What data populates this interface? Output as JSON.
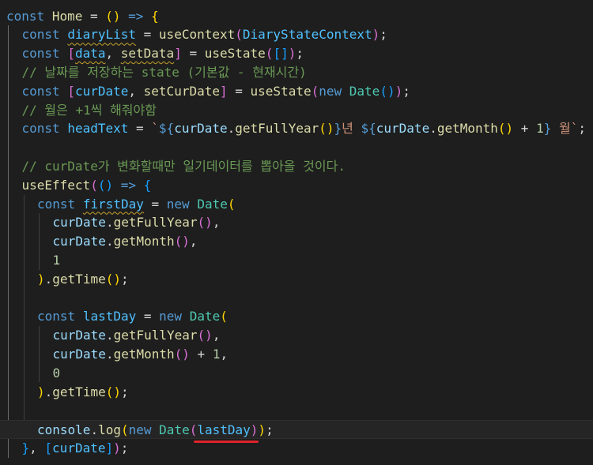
{
  "colors": {
    "background": "#1e1e1e",
    "keyword": "#569cd6",
    "control": "#c586c0",
    "function": "#dcdcaa",
    "variable": "#9cdcfe",
    "constant": "#4fc1ff",
    "type": "#4ec9b0",
    "number": "#b5cea8",
    "string": "#ce9178",
    "comment": "#6a9955",
    "text": "#d4d4d4",
    "bracket1": "#ffd700",
    "bracket2": "#da70d6",
    "bracket3": "#179fff",
    "guide": "#404040",
    "active_guide": "#6b6b6b",
    "annotation": "#e0232a"
  },
  "code": {
    "lines": [
      {
        "indent": 0,
        "tokens": [
          {
            "t": "const",
            "c": "#569cd6"
          },
          {
            "t": " ",
            "c": "#d4d4d4"
          },
          {
            "t": "Home",
            "c": "#dcdcaa"
          },
          {
            "t": " = ",
            "c": "#d4d4d4"
          },
          {
            "t": "()",
            "c": "#ffd700"
          },
          {
            "t": " ",
            "c": "#d4d4d4"
          },
          {
            "t": "=>",
            "c": "#569cd6"
          },
          {
            "t": " ",
            "c": "#d4d4d4"
          },
          {
            "t": "{",
            "c": "#ffd700"
          }
        ]
      },
      {
        "indent": 1,
        "tokens": [
          {
            "t": "const",
            "c": "#569cd6"
          },
          {
            "t": " ",
            "c": "#d4d4d4"
          },
          {
            "t": "diaryList",
            "c": "#4fc1ff",
            "s": 1
          },
          {
            "t": " = ",
            "c": "#d4d4d4"
          },
          {
            "t": "useContext",
            "c": "#dcdcaa"
          },
          {
            "t": "(",
            "c": "#da70d6"
          },
          {
            "t": "DiaryStateContext",
            "c": "#4fc1ff"
          },
          {
            "t": ")",
            "c": "#da70d6"
          },
          {
            "t": ";",
            "c": "#d4d4d4"
          }
        ]
      },
      {
        "indent": 1,
        "tokens": [
          {
            "t": "const",
            "c": "#569cd6"
          },
          {
            "t": " ",
            "c": "#d4d4d4"
          },
          {
            "t": "[",
            "c": "#da70d6"
          },
          {
            "t": "data",
            "c": "#4fc1ff",
            "s": 1
          },
          {
            "t": ", ",
            "c": "#d4d4d4"
          },
          {
            "t": "setData",
            "c": "#dcdcaa",
            "s": 1
          },
          {
            "t": "]",
            "c": "#da70d6"
          },
          {
            "t": " = ",
            "c": "#d4d4d4"
          },
          {
            "t": "useState",
            "c": "#dcdcaa"
          },
          {
            "t": "(",
            "c": "#da70d6"
          },
          {
            "t": "[]",
            "c": "#179fff"
          },
          {
            "t": ")",
            "c": "#da70d6"
          },
          {
            "t": ";",
            "c": "#d4d4d4"
          }
        ]
      },
      {
        "indent": 1,
        "tokens": [
          {
            "t": "// 날짜를 저장하는 state (기본값 - 현재시간)",
            "c": "#6a9955"
          }
        ]
      },
      {
        "indent": 1,
        "tokens": [
          {
            "t": "const",
            "c": "#569cd6"
          },
          {
            "t": " ",
            "c": "#d4d4d4"
          },
          {
            "t": "[",
            "c": "#da70d6"
          },
          {
            "t": "curDate",
            "c": "#4fc1ff"
          },
          {
            "t": ", ",
            "c": "#d4d4d4"
          },
          {
            "t": "setCurDate",
            "c": "#dcdcaa"
          },
          {
            "t": "]",
            "c": "#da70d6"
          },
          {
            "t": " = ",
            "c": "#d4d4d4"
          },
          {
            "t": "useState",
            "c": "#dcdcaa"
          },
          {
            "t": "(",
            "c": "#da70d6"
          },
          {
            "t": "new",
            "c": "#569cd6"
          },
          {
            "t": " ",
            "c": "#d4d4d4"
          },
          {
            "t": "Date",
            "c": "#4ec9b0"
          },
          {
            "t": "()",
            "c": "#179fff"
          },
          {
            "t": ")",
            "c": "#da70d6"
          },
          {
            "t": ";",
            "c": "#d4d4d4"
          }
        ]
      },
      {
        "indent": 1,
        "tokens": [
          {
            "t": "// 월은 +1씩 해줘야함",
            "c": "#6a9955"
          }
        ]
      },
      {
        "indent": 1,
        "tokens": [
          {
            "t": "const",
            "c": "#569cd6"
          },
          {
            "t": " ",
            "c": "#d4d4d4"
          },
          {
            "t": "headText",
            "c": "#4fc1ff"
          },
          {
            "t": " = ",
            "c": "#d4d4d4"
          },
          {
            "t": "`",
            "c": "#ce9178"
          },
          {
            "t": "${",
            "c": "#569cd6"
          },
          {
            "t": "curDate",
            "c": "#9cdcfe"
          },
          {
            "t": ".",
            "c": "#d4d4d4"
          },
          {
            "t": "getFullYear",
            "c": "#dcdcaa"
          },
          {
            "t": "()",
            "c": "#ffd700"
          },
          {
            "t": "}",
            "c": "#569cd6"
          },
          {
            "t": "년 ",
            "c": "#ce9178"
          },
          {
            "t": "${",
            "c": "#569cd6"
          },
          {
            "t": "curDate",
            "c": "#9cdcfe"
          },
          {
            "t": ".",
            "c": "#d4d4d4"
          },
          {
            "t": "getMonth",
            "c": "#dcdcaa"
          },
          {
            "t": "()",
            "c": "#ffd700"
          },
          {
            "t": " + ",
            "c": "#d4d4d4"
          },
          {
            "t": "1",
            "c": "#b5cea8"
          },
          {
            "t": "}",
            "c": "#569cd6"
          },
          {
            "t": " 월`",
            "c": "#ce9178"
          },
          {
            "t": ";",
            "c": "#d4d4d4"
          }
        ]
      },
      {
        "indent": 1,
        "tokens": []
      },
      {
        "indent": 1,
        "tokens": [
          {
            "t": "// curDate가 변화할때만 일기데이터를 뽑아올 것이다.",
            "c": "#6a9955"
          }
        ]
      },
      {
        "indent": 1,
        "tokens": [
          {
            "t": "useEffect",
            "c": "#dcdcaa"
          },
          {
            "t": "(",
            "c": "#da70d6"
          },
          {
            "t": "()",
            "c": "#179fff"
          },
          {
            "t": " ",
            "c": "#d4d4d4"
          },
          {
            "t": "=>",
            "c": "#569cd6"
          },
          {
            "t": " ",
            "c": "#d4d4d4"
          },
          {
            "t": "{",
            "c": "#179fff"
          }
        ]
      },
      {
        "indent": 2,
        "tokens": [
          {
            "t": "const",
            "c": "#569cd6"
          },
          {
            "t": " ",
            "c": "#d4d4d4"
          },
          {
            "t": "firstDay",
            "c": "#4fc1ff",
            "s": 1
          },
          {
            "t": " = ",
            "c": "#d4d4d4"
          },
          {
            "t": "new",
            "c": "#569cd6"
          },
          {
            "t": " ",
            "c": "#d4d4d4"
          },
          {
            "t": "Date",
            "c": "#4ec9b0"
          },
          {
            "t": "(",
            "c": "#ffd700"
          }
        ]
      },
      {
        "indent": 3,
        "tokens": [
          {
            "t": "curDate",
            "c": "#9cdcfe"
          },
          {
            "t": ".",
            "c": "#d4d4d4"
          },
          {
            "t": "getFullYear",
            "c": "#dcdcaa"
          },
          {
            "t": "()",
            "c": "#da70d6"
          },
          {
            "t": ",",
            "c": "#d4d4d4"
          }
        ]
      },
      {
        "indent": 3,
        "tokens": [
          {
            "t": "curDate",
            "c": "#9cdcfe"
          },
          {
            "t": ".",
            "c": "#d4d4d4"
          },
          {
            "t": "getMonth",
            "c": "#dcdcaa"
          },
          {
            "t": "()",
            "c": "#da70d6"
          },
          {
            "t": ",",
            "c": "#d4d4d4"
          }
        ]
      },
      {
        "indent": 3,
        "tokens": [
          {
            "t": "1",
            "c": "#b5cea8"
          }
        ]
      },
      {
        "indent": 2,
        "tokens": [
          {
            "t": ")",
            "c": "#ffd700"
          },
          {
            "t": ".",
            "c": "#d4d4d4"
          },
          {
            "t": "getTime",
            "c": "#dcdcaa"
          },
          {
            "t": "()",
            "c": "#ffd700"
          },
          {
            "t": ";",
            "c": "#d4d4d4"
          }
        ]
      },
      {
        "indent": 2,
        "tokens": []
      },
      {
        "indent": 2,
        "tokens": [
          {
            "t": "const",
            "c": "#569cd6"
          },
          {
            "t": " ",
            "c": "#d4d4d4"
          },
          {
            "t": "lastDay",
            "c": "#4fc1ff"
          },
          {
            "t": " = ",
            "c": "#d4d4d4"
          },
          {
            "t": "new",
            "c": "#569cd6"
          },
          {
            "t": " ",
            "c": "#d4d4d4"
          },
          {
            "t": "Date",
            "c": "#4ec9b0"
          },
          {
            "t": "(",
            "c": "#ffd700"
          }
        ]
      },
      {
        "indent": 3,
        "tokens": [
          {
            "t": "curDate",
            "c": "#9cdcfe"
          },
          {
            "t": ".",
            "c": "#d4d4d4"
          },
          {
            "t": "getFullYear",
            "c": "#dcdcaa"
          },
          {
            "t": "()",
            "c": "#da70d6"
          },
          {
            "t": ",",
            "c": "#d4d4d4"
          }
        ]
      },
      {
        "indent": 3,
        "tokens": [
          {
            "t": "curDate",
            "c": "#9cdcfe"
          },
          {
            "t": ".",
            "c": "#d4d4d4"
          },
          {
            "t": "getMonth",
            "c": "#dcdcaa"
          },
          {
            "t": "()",
            "c": "#da70d6"
          },
          {
            "t": " + ",
            "c": "#d4d4d4"
          },
          {
            "t": "1",
            "c": "#b5cea8"
          },
          {
            "t": ",",
            "c": "#d4d4d4"
          }
        ]
      },
      {
        "indent": 3,
        "tokens": [
          {
            "t": "0",
            "c": "#b5cea8"
          }
        ]
      },
      {
        "indent": 2,
        "tokens": [
          {
            "t": ")",
            "c": "#ffd700"
          },
          {
            "t": ".",
            "c": "#d4d4d4"
          },
          {
            "t": "getTime",
            "c": "#dcdcaa"
          },
          {
            "t": "()",
            "c": "#ffd700"
          },
          {
            "t": ";",
            "c": "#d4d4d4"
          }
        ]
      },
      {
        "indent": 2,
        "tokens": []
      },
      {
        "indent": 2,
        "active": true,
        "tokens": [
          {
            "t": "console",
            "c": "#9cdcfe"
          },
          {
            "t": ".",
            "c": "#d4d4d4"
          },
          {
            "t": "log",
            "c": "#dcdcaa"
          },
          {
            "t": "(",
            "c": "#ffd700"
          },
          {
            "t": "new",
            "c": "#569cd6"
          },
          {
            "t": " ",
            "c": "#d4d4d4"
          },
          {
            "t": "Date",
            "c": "#4ec9b0"
          },
          {
            "t": "(",
            "c": "#da70d6"
          },
          {
            "t": "lastDay",
            "c": "#4fc1ff"
          },
          {
            "t": ")",
            "c": "#da70d6"
          },
          {
            "t": ")",
            "c": "#ffd700"
          },
          {
            "t": ";",
            "c": "#d4d4d4"
          }
        ]
      },
      {
        "indent": 1,
        "tokens": [
          {
            "t": "}",
            "c": "#179fff"
          },
          {
            "t": ", ",
            "c": "#d4d4d4"
          },
          {
            "t": "[",
            "c": "#179fff"
          },
          {
            "t": "curDate",
            "c": "#4fc1ff"
          },
          {
            "t": "]",
            "c": "#179fff"
          },
          {
            "t": ")",
            "c": "#da70d6"
          },
          {
            "t": ";",
            "c": "#d4d4d4"
          }
        ]
      }
    ]
  }
}
